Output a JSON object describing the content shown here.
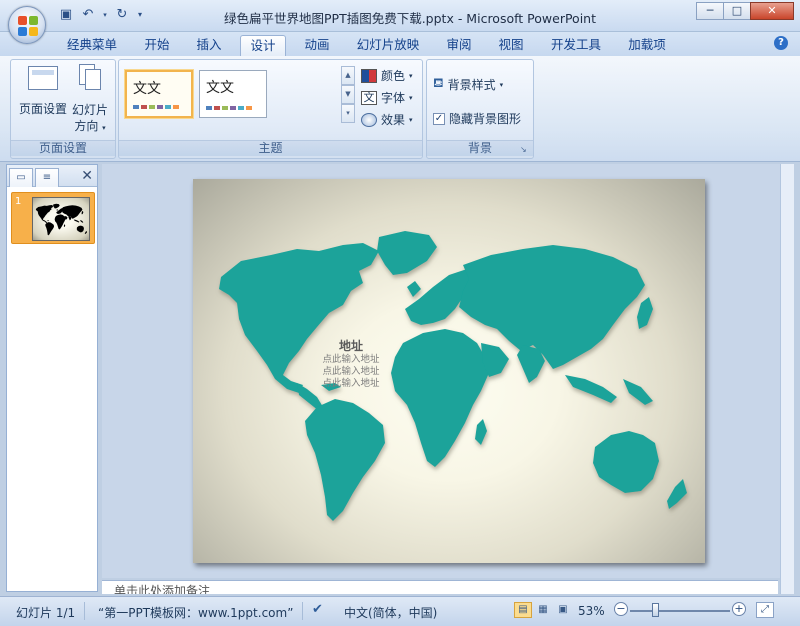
{
  "window": {
    "title": "绿色扁平世界地图PPT插图免费下载.pptx - Microsoft PowerPoint",
    "minimize": "─",
    "maximize": "□",
    "close": "✕"
  },
  "quick_access": {
    "save_icon": "floppy-icon",
    "undo_icon": "undo-icon",
    "redo_icon": "repeat-icon",
    "customize_icon": "dropdown-icon"
  },
  "tabs": [
    {
      "label": "经典菜单"
    },
    {
      "label": "开始"
    },
    {
      "label": "插入"
    },
    {
      "label": "设计"
    },
    {
      "label": "动画"
    },
    {
      "label": "幻灯片放映"
    },
    {
      "label": "审阅"
    },
    {
      "label": "视图"
    },
    {
      "label": "开发工具"
    },
    {
      "label": "加载项"
    }
  ],
  "active_tab": "设计",
  "ribbon": {
    "page_setup_group": {
      "label": "页面设置",
      "page_setup_button": "页面设置",
      "orientation_button_line1": "幻灯片",
      "orientation_button_line2": "方向"
    },
    "themes_group": {
      "label": "主题",
      "theme1_text": "文文",
      "theme2_text": "文文",
      "colors": "颜色",
      "fonts": "字体",
      "effects": "效果"
    },
    "background_group": {
      "label": "背景",
      "background_styles": "背景样式",
      "hide_background_graphics": "隐藏背景图形",
      "hide_background_checked": true
    }
  },
  "left_pane": {
    "slide_number": "1"
  },
  "slide": {
    "address_heading": "地址",
    "address_lines": [
      "点此输入地址",
      "点此输入地址",
      "点此输入地址"
    ],
    "map_color": "#1aa39a"
  },
  "notes_placeholder": "单击此处添加备注",
  "status": {
    "slide_indicator": "幻灯片 1/1",
    "theme_name": "“第一PPT模板网：www.1ppt.com”",
    "language": "中文(简体，中国)",
    "zoom_level": "53%",
    "zoom_fraction": 0.53
  }
}
